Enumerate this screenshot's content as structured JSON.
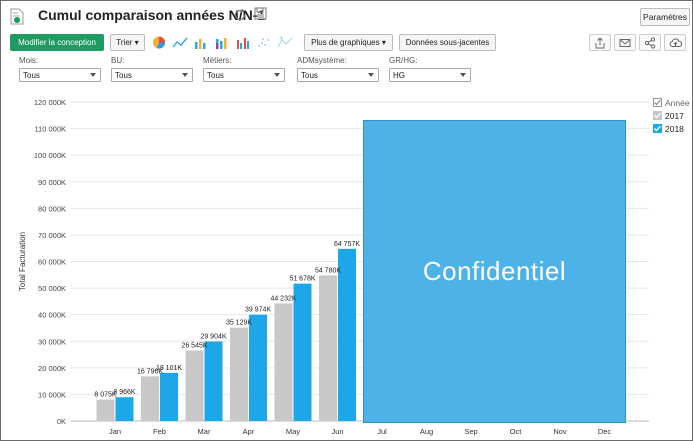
{
  "header": {
    "title": "Cumul comparaison années N/N-1",
    "params_label": "Paramètres"
  },
  "toolbar": {
    "modify_label": "Modifier la conception",
    "sort_label": "Trier ▾",
    "more_charts_label": "Plus de graphiques ▾",
    "underlying_label": "Données sous-jacentes",
    "chart_type_icons": [
      "pie-chart-icon",
      "line-chart-icon",
      "bar-chart-icon",
      "stacked-bar-chart-icon",
      "grouped-bar-chart-icon",
      "scatter-chart-icon",
      "area-map-icon"
    ],
    "right_icons": [
      "export-icon",
      "email-icon",
      "share-icon",
      "cloud-upload-icon"
    ]
  },
  "filters": [
    {
      "label": "Mois:",
      "value": "Tous"
    },
    {
      "label": "BU:",
      "value": "Tous"
    },
    {
      "label": "Métiers:",
      "value": "Tous"
    },
    {
      "label": "ADMsystème:",
      "value": "Tous"
    },
    {
      "label": "GR/HG:",
      "value": "HG"
    }
  ],
  "overlay": {
    "text": "Confidentiel",
    "color": "#4db3e6"
  },
  "legend": {
    "title": "Année",
    "items": [
      {
        "name": "2017",
        "color": "#c8c8c8"
      },
      {
        "name": "2018",
        "color": "#1ea7e8"
      }
    ]
  },
  "chart_data": {
    "type": "bar",
    "categories": [
      "Jan",
      "Feb",
      "Mar",
      "Apr",
      "May",
      "Jun",
      "Jul",
      "Aug",
      "Sep",
      "Oct",
      "Nov",
      "Dec"
    ],
    "series": [
      {
        "name": "2017",
        "color": "#c8c8c8",
        "values": [
          8075,
          16796,
          26545,
          35129,
          44232,
          54780,
          null,
          null,
          null,
          null,
          null,
          null
        ],
        "labels": [
          "8 075K",
          "16 796K",
          "26 545K",
          "35 129K",
          "44 232K",
          "54 780K"
        ]
      },
      {
        "name": "2018",
        "color": "#1ea7e8",
        "values": [
          8966,
          18101,
          29904,
          39974,
          51678,
          64757,
          null,
          null,
          null,
          null,
          null,
          null
        ],
        "labels": [
          "8 966K",
          "18 101K",
          "29 904K",
          "39 974K",
          "51 678K",
          "64 757K"
        ]
      }
    ],
    "y_ticks": [
      "0K",
      "10 000K",
      "20 000K",
      "30 000K",
      "40 000K",
      "50 000K",
      "60 000K",
      "70 000K",
      "80 000K",
      "90 000K",
      "100 000K",
      "110 000K",
      "120 000K"
    ],
    "ylabel": "Total Facturation",
    "xlabel": "",
    "ylim": [
      0,
      120000
    ],
    "grid": true,
    "legend_position": "right"
  }
}
